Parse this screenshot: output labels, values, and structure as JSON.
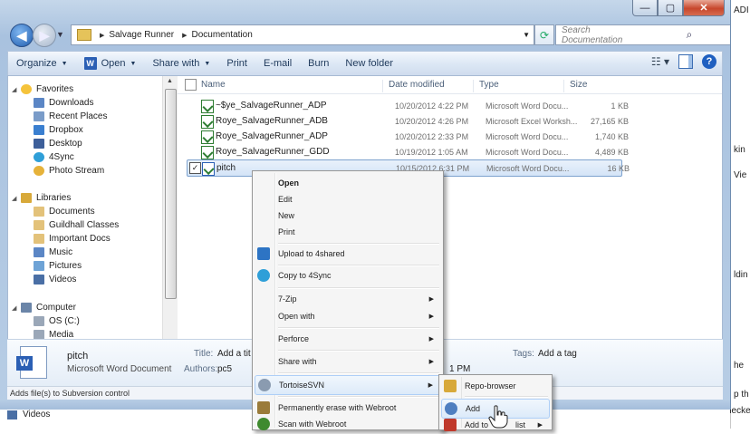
{
  "window": {
    "breadcrumb": [
      "Salvage Runner",
      "Documentation"
    ],
    "search_placeholder": "Search Documentation"
  },
  "toolbar": {
    "organize": "Organize",
    "open": "Open",
    "share_with": "Share with",
    "print": "Print",
    "email": "E-mail",
    "burn": "Burn",
    "new_folder": "New folder"
  },
  "nav": {
    "favorites": "Favorites",
    "favorites_items": [
      "Downloads",
      "Recent Places",
      "Dropbox",
      "Desktop",
      "4Sync",
      "Photo Stream"
    ],
    "libraries": "Libraries",
    "libraries_items": [
      "Documents",
      "Guildhall Classes",
      "Important Docs",
      "Music",
      "Pictures",
      "Videos"
    ],
    "computer": "Computer",
    "computer_items": [
      "OS (C:)",
      "Media"
    ]
  },
  "columns": {
    "name": "Name",
    "date_modified": "Date modified",
    "type": "Type",
    "size": "Size"
  },
  "files": [
    {
      "name": "~$ye_SalvageRunner_ADP",
      "date": "10/20/2012 4:22 PM",
      "type": "Microsoft Word Docu...",
      "size": "1 KB"
    },
    {
      "name": "Roye_SalvageRunner_ADB",
      "date": "10/20/2012 4:26 PM",
      "type": "Microsoft Excel Worksh...",
      "size": "27,165 KB"
    },
    {
      "name": "Roye_SalvageRunner_ADP",
      "date": "10/20/2012 2:33 PM",
      "type": "Microsoft Word Docu...",
      "size": "1,740 KB"
    },
    {
      "name": "Roye_SalvageRunner_GDD",
      "date": "10/19/2012 1:05 AM",
      "type": "Microsoft Word Docu...",
      "size": "4,489 KB"
    },
    {
      "name": "pitch",
      "date": "10/15/2012 6:31 PM",
      "type": "Microsoft Word Docu...",
      "size": "16 KB"
    }
  ],
  "details": {
    "name": "pitch",
    "type": "Microsoft Word Document",
    "title_label": "Title:",
    "title_value": "Add a tit",
    "authors_label": "Authors:",
    "authors_value": "pc5",
    "tags_label": "Tags:",
    "tags_value": "Add a tag",
    "date_fragment": "1 PM"
  },
  "status": "Adds file(s) to Subversion control",
  "taskbar_item": "Videos",
  "background_fragments": [
    "ADI",
    "kin",
    "Vie",
    "ldin",
    "he",
    "p th",
    "checke"
  ],
  "context_menu": {
    "items": [
      "Open",
      "Edit",
      "New",
      "Print",
      "Upload to 4shared",
      "Copy to 4Sync",
      "7-Zip",
      "Open with",
      "Perforce",
      "Share with",
      "TortoiseSVN",
      "Permanently erase with Webroot",
      "Scan with Webroot"
    ]
  },
  "svn_submenu": {
    "items": [
      "Repo-browser",
      "Add",
      "Add to",
      "list"
    ]
  }
}
